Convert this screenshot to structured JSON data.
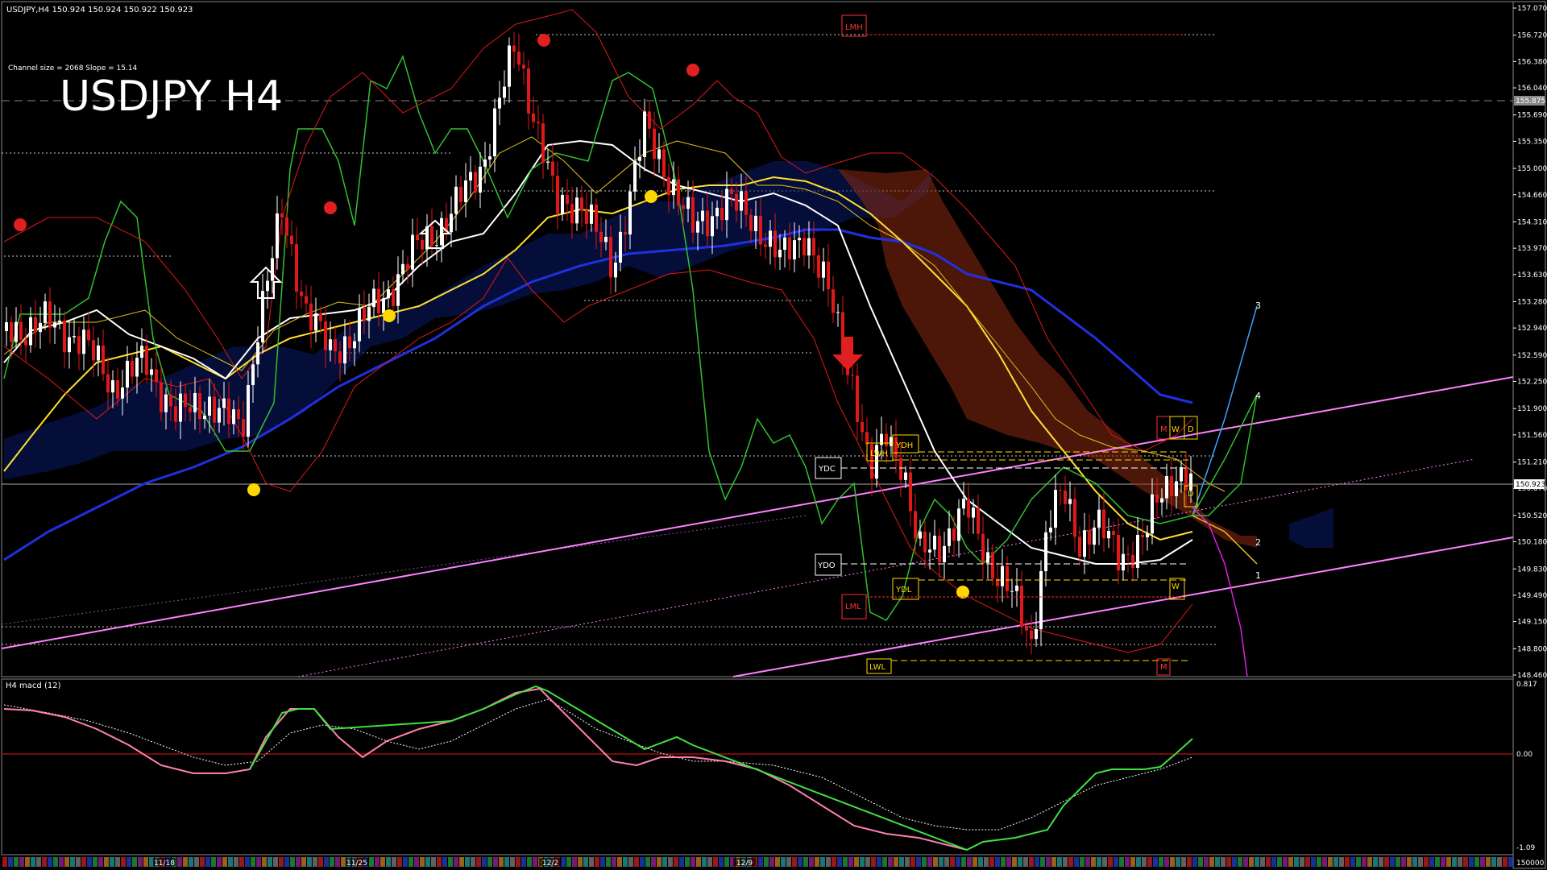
{
  "header": {
    "symbol_line": "USDJPY,H4  150.924 150.924 150.922 150.923",
    "channel_info": "Channel size = 2068 Slope = 15.14",
    "big_title": "USDJPY H4"
  },
  "indicator": {
    "label": "H4  macd (12)"
  },
  "chart_data": {
    "type": "candlestick",
    "title": "USDJPY H4",
    "ylim": [
      148.46,
      157.07
    ],
    "y_ticks": [
      157.07,
      156.72,
      156.38,
      156.04,
      155.69,
      155.35,
      155.0,
      154.66,
      154.31,
      153.97,
      153.63,
      153.28,
      152.94,
      152.59,
      152.25,
      151.9,
      151.56,
      151.21,
      150.87,
      150.52,
      150.18,
      149.83,
      149.49,
      149.15,
      148.8,
      148.46
    ],
    "x_labels": [
      "11/18",
      "11/25",
      "12/2",
      "12/9"
    ],
    "price_labels": {
      "current": "150.923",
      "ref": "155.875"
    },
    "levels": [
      {
        "label": "LMH",
        "value": 156.8,
        "color": "#ff3030"
      },
      {
        "label": "YDH",
        "value": 151.15,
        "color": "#ffd700"
      },
      {
        "label": "LWH",
        "value": 151.0,
        "color": "#ffd700"
      },
      {
        "label": "YDC",
        "value": 150.88,
        "color": "#ffffff"
      },
      {
        "label": "YDO",
        "value": 149.9,
        "color": "#ffffff"
      },
      {
        "label": "YDL",
        "value": 149.7,
        "color": "#ffd700"
      },
      {
        "label": "LML",
        "value": 149.45,
        "color": "#ff3030"
      },
      {
        "label": "LWL",
        "value": 148.6,
        "color": "#ffd700"
      }
    ],
    "box_tags": [
      "M",
      "W",
      "D",
      "D",
      "W",
      "M"
    ],
    "projection_labels": [
      "3",
      "4",
      "2",
      "1"
    ],
    "macd": {
      "ticks": [
        "0.817",
        "0.00",
        "-1.09"
      ],
      "ylim": [
        -1.09,
        0.817
      ]
    },
    "volume_scale_label": "150000"
  }
}
